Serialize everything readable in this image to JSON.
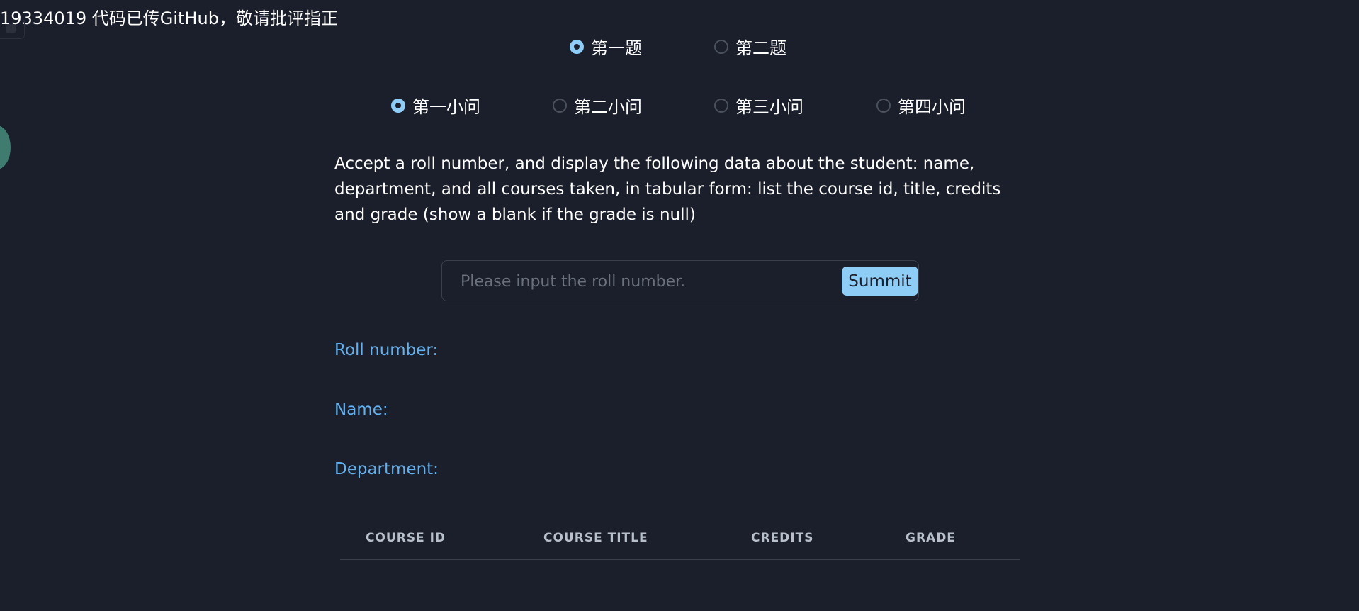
{
  "header_note": "19334019 代码已传GitHub，敬请批评指正",
  "questions": {
    "items": [
      {
        "label": "第一题",
        "checked": true
      },
      {
        "label": "第二题",
        "checked": false
      }
    ]
  },
  "sub_questions": {
    "items": [
      {
        "label": "第一小问",
        "checked": true
      },
      {
        "label": "第二小问",
        "checked": false
      },
      {
        "label": "第三小问",
        "checked": false
      },
      {
        "label": "第四小问",
        "checked": false
      }
    ]
  },
  "description": "Accept a roll number, and display the following data about the student: name, department, and all courses taken, in tabular form: list the course id, title, credits and grade (show a blank if the grade is null)",
  "search": {
    "placeholder": "Please input the roll number.",
    "value": "",
    "submit_label": "Summit"
  },
  "info": {
    "roll_number_label": "Roll number:",
    "name_label": "Name:",
    "department_label": "Department:"
  },
  "table": {
    "headers": [
      "COURSE ID",
      "COURSE TITLE",
      "CREDITS",
      "GRADE"
    ],
    "rows": []
  },
  "colors": {
    "background": "#1b1f2b",
    "accent": "#8ecdf6",
    "label_blue": "#62b0ee"
  }
}
